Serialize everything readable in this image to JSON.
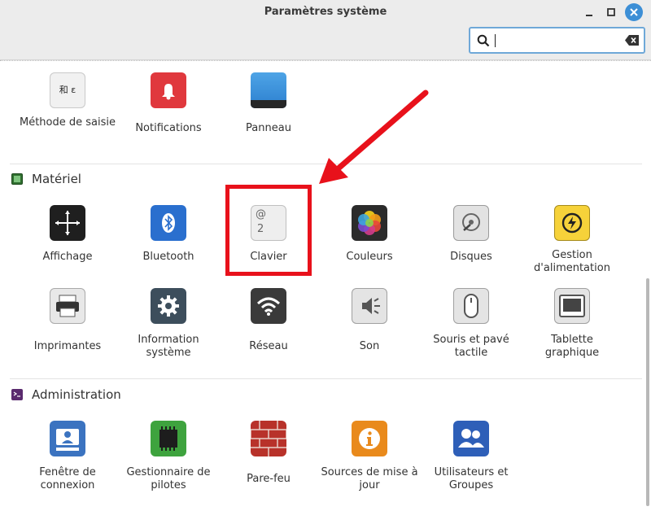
{
  "window": {
    "title": "Paramètres système"
  },
  "search": {
    "value": "",
    "placeholder": ""
  },
  "sections": {
    "hardware": {
      "title": "Matériel"
    },
    "admin": {
      "title": "Administration"
    }
  },
  "items": {
    "input_method": "Méthode de saisie",
    "notifications": "Notifications",
    "panel": "Panneau",
    "display": "Affichage",
    "bluetooth": "Bluetooth",
    "keyboard": "Clavier",
    "colors": "Couleurs",
    "disks": "Disques",
    "power": "Gestion d'alimentation",
    "printers": "Imprimantes",
    "system_info": "Information système",
    "network": "Réseau",
    "sound": "Son",
    "mouse": "Souris et pavé tactile",
    "tablet": "Tablette graphique",
    "login_window": "Fenêtre de connexion",
    "driver_manager": "Gestionnaire de pilotes",
    "firewall": "Pare-feu",
    "software_sources": "Sources de mise à jour",
    "users_groups": "Utilisateurs et Groupes"
  },
  "icon_glyphs": {
    "input_method": "和 ε",
    "keyboard_top": "@",
    "keyboard_bottom": "2"
  },
  "colors": {
    "accent": "#3d8fd6",
    "highlight": "#e8111b"
  }
}
